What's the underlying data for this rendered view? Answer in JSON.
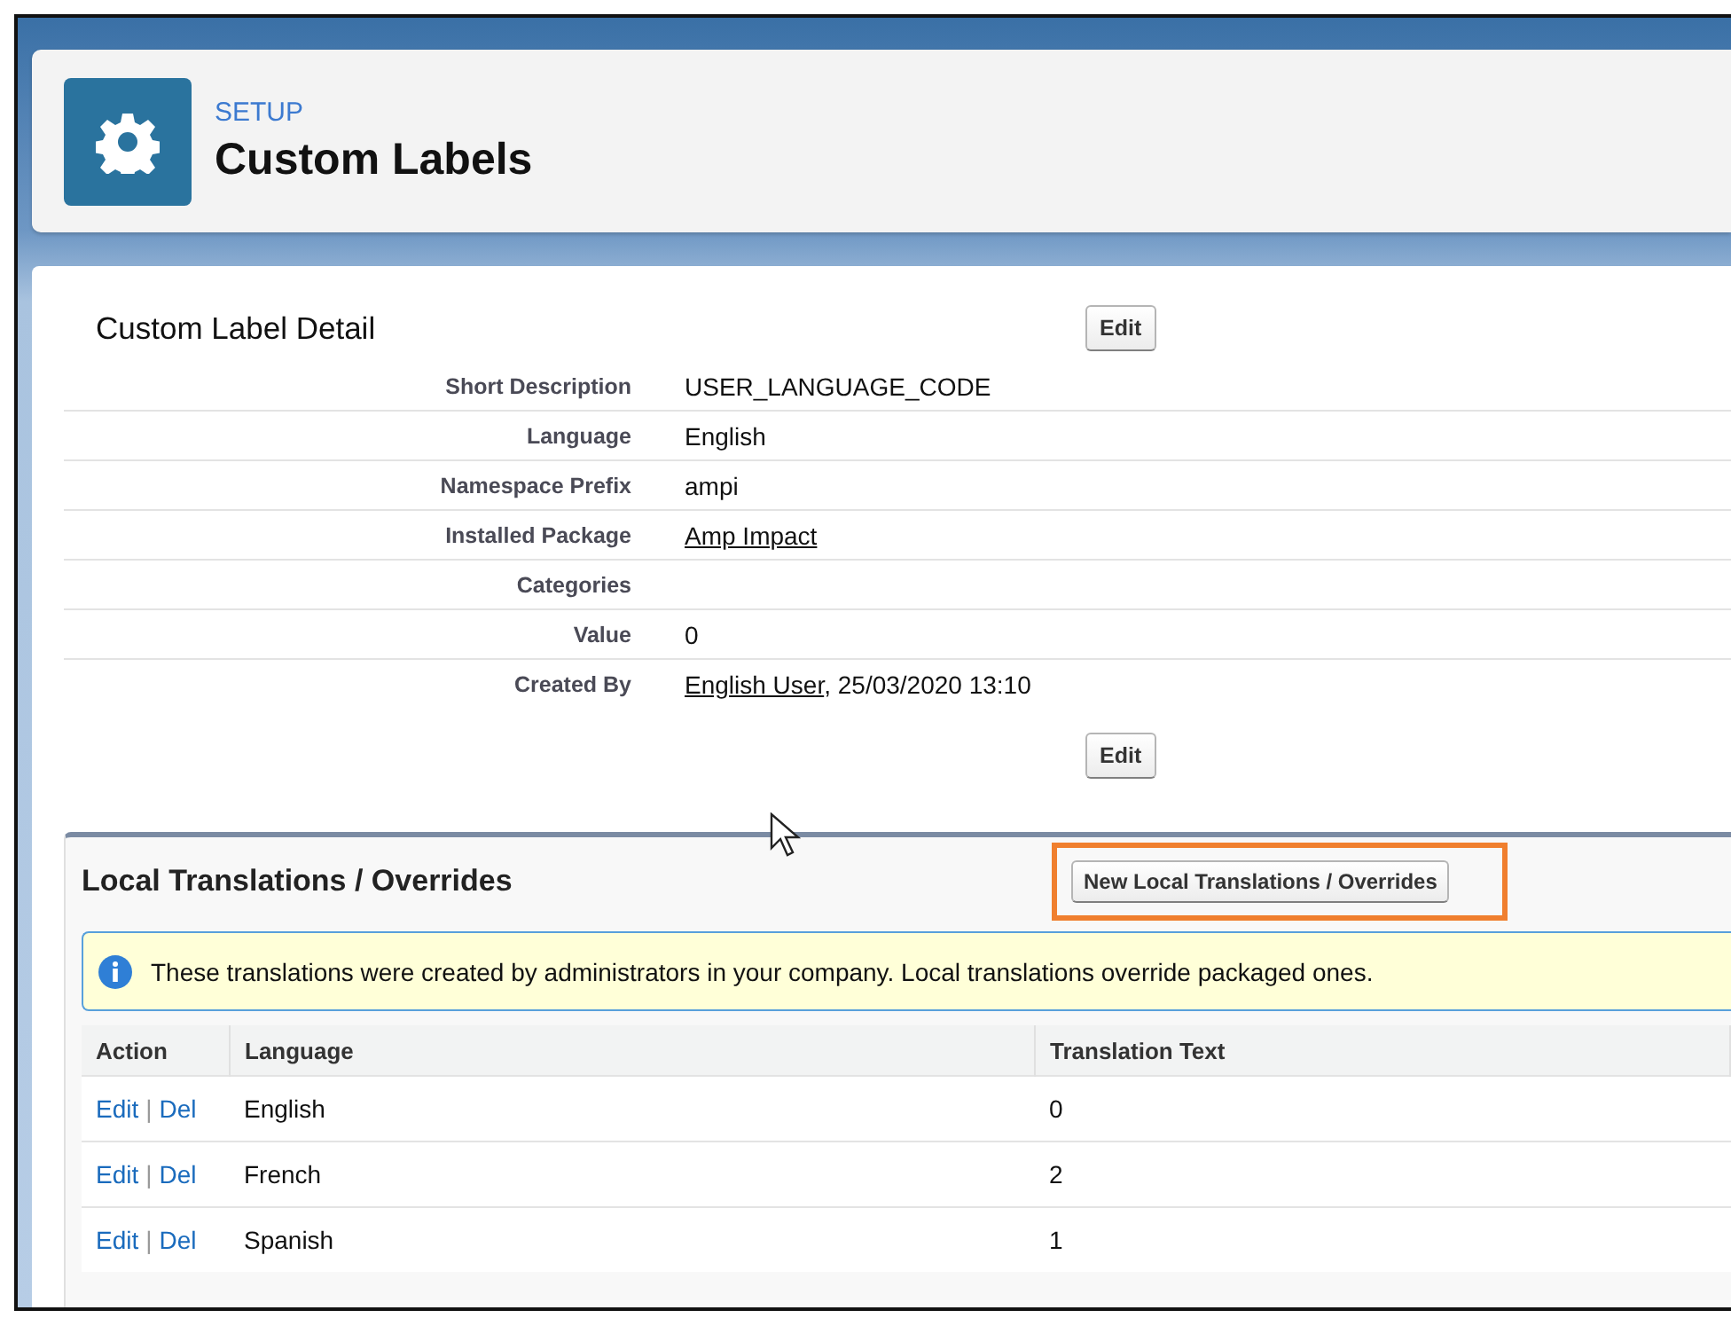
{
  "header": {
    "section": "SETUP",
    "title": "Custom Labels"
  },
  "detail": {
    "title": "Custom Label Detail",
    "edit_buttons": [
      "Edit",
      "Edit"
    ],
    "fields": [
      {
        "label": "Short Description",
        "value": "USER_LANGUAGE_CODE",
        "link": false
      },
      {
        "label": "Language",
        "value": "English",
        "link": false
      },
      {
        "label": "Namespace Prefix",
        "value": "ampi",
        "link": false
      },
      {
        "label": "Installed Package",
        "value": "Amp Impact",
        "link": true
      },
      {
        "label": "Categories"
      },
      {
        "label": "Value",
        "value": "0",
        "link": false
      },
      {
        "label": "Created By",
        "value": "English User",
        "link": true,
        "suffix": ", 25/03/2020 13:10"
      }
    ]
  },
  "translations": {
    "title": "Local Translations / Overrides",
    "new_button": {
      "label": "New Local Translations / Overrides",
      "highlighted": true
    },
    "info": "These translations were created by administrators in your company. Local translations override packaged ones.",
    "columns": [
      "Action",
      "Language",
      "Translation Text"
    ],
    "rows": [
      {
        "edit": "Edit",
        "separator": "|",
        "del": "Del",
        "language": "English",
        "text": "0"
      },
      {
        "edit": "Edit",
        "separator": "|",
        "del": "Del",
        "language": "French",
        "text": "2"
      },
      {
        "edit": "Edit",
        "separator": "|",
        "del": "Del",
        "language": "Spanish",
        "text": "1"
      }
    ]
  }
}
